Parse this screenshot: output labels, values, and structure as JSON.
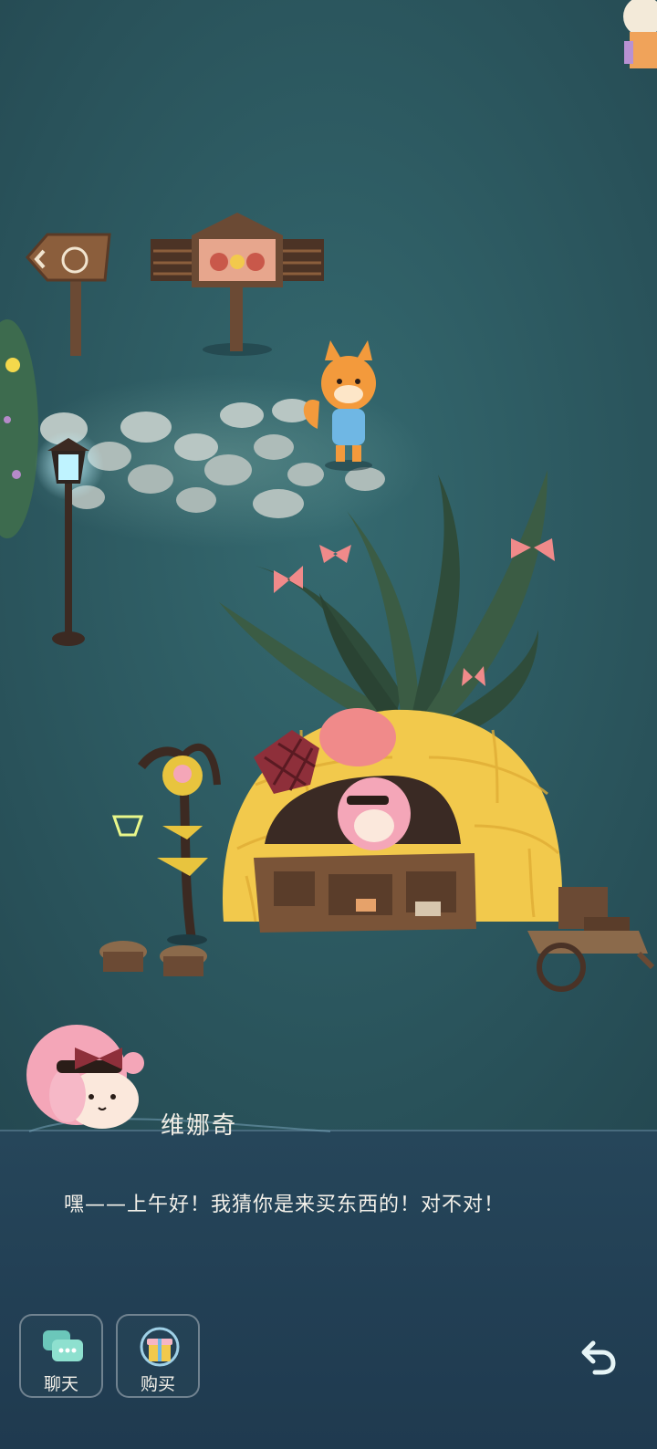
{
  "dialog": {
    "speaker": "维娜奇",
    "text": "嘿——上午好！我猜你是来买东西的！对不对！"
  },
  "actions": {
    "chat_label": "聊天",
    "buy_label": "购买"
  },
  "icons": {
    "chat": "chat-bubble-icon",
    "buy": "gift-box-icon",
    "back": "undo-arrow-icon"
  },
  "colors": {
    "background": "#2c5a62",
    "panel": "#223f54",
    "text": "#f4f1ea",
    "shop_yellow": "#f2c94c",
    "accent_pink": "#f08a8a"
  }
}
